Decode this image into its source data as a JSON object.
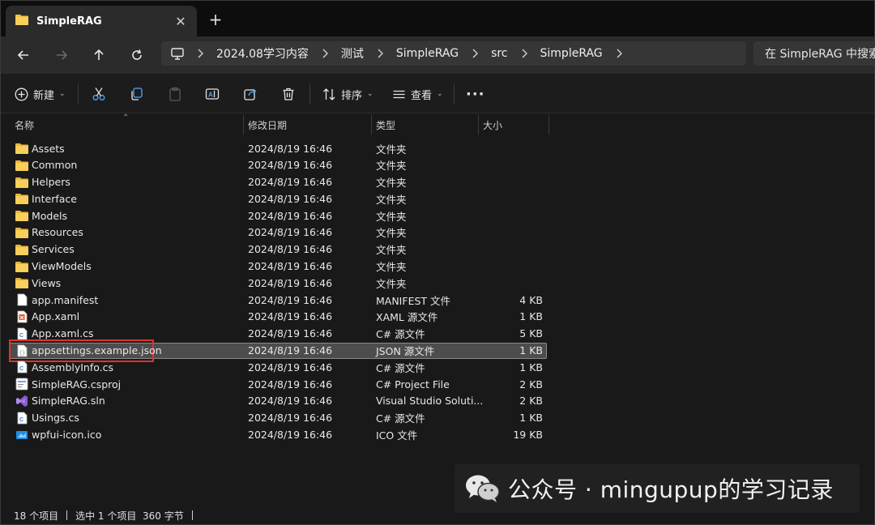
{
  "tab": {
    "title": "SimpleRAG",
    "close_glyph": "✕",
    "new_tab_glyph": "+"
  },
  "address": {
    "crumbs": [
      "2024.08学习内容",
      "测试",
      "SimpleRAG",
      "src",
      "SimpleRAG"
    ],
    "search_placeholder": "在 SimpleRAG 中搜索"
  },
  "toolbar": {
    "new_label": "新建",
    "sort_label": "排序",
    "view_label": "查看",
    "more_glyph": "···"
  },
  "columns": {
    "name": "名称",
    "date": "修改日期",
    "type": "类型",
    "size": "大小"
  },
  "files": [
    {
      "name": "Assets",
      "date": "2024/8/19 16:46",
      "type": "文件夹",
      "size": "",
      "icon": "folder-icon"
    },
    {
      "name": "Common",
      "date": "2024/8/19 16:46",
      "type": "文件夹",
      "size": "",
      "icon": "folder-icon"
    },
    {
      "name": "Helpers",
      "date": "2024/8/19 16:46",
      "type": "文件夹",
      "size": "",
      "icon": "folder-icon"
    },
    {
      "name": "Interface",
      "date": "2024/8/19 16:46",
      "type": "文件夹",
      "size": "",
      "icon": "folder-icon"
    },
    {
      "name": "Models",
      "date": "2024/8/19 16:46",
      "type": "文件夹",
      "size": "",
      "icon": "folder-icon"
    },
    {
      "name": "Resources",
      "date": "2024/8/19 16:46",
      "type": "文件夹",
      "size": "",
      "icon": "folder-icon"
    },
    {
      "name": "Services",
      "date": "2024/8/19 16:46",
      "type": "文件夹",
      "size": "",
      "icon": "folder-icon"
    },
    {
      "name": "ViewModels",
      "date": "2024/8/19 16:46",
      "type": "文件夹",
      "size": "",
      "icon": "folder-icon"
    },
    {
      "name": "Views",
      "date": "2024/8/19 16:46",
      "type": "文件夹",
      "size": "",
      "icon": "folder-icon"
    },
    {
      "name": "app.manifest",
      "date": "2024/8/19 16:46",
      "type": "MANIFEST 文件",
      "size": "4 KB",
      "icon": "file-icon"
    },
    {
      "name": "App.xaml",
      "date": "2024/8/19 16:46",
      "type": "XAML 源文件",
      "size": "1 KB",
      "icon": "xaml-file-icon"
    },
    {
      "name": "App.xaml.cs",
      "date": "2024/8/19 16:46",
      "type": "C# 源文件",
      "size": "5 KB",
      "icon": "csharp-file-icon"
    },
    {
      "name": "appsettings.example.json",
      "date": "2024/8/19 16:46",
      "type": "JSON 源文件",
      "size": "1 KB",
      "icon": "json-file-icon",
      "selected": true
    },
    {
      "name": "AssemblyInfo.cs",
      "date": "2024/8/19 16:46",
      "type": "C# 源文件",
      "size": "1 KB",
      "icon": "csharp-file-icon"
    },
    {
      "name": "SimpleRAG.csproj",
      "date": "2024/8/19 16:46",
      "type": "C# Project File",
      "size": "2 KB",
      "icon": "csproj-file-icon"
    },
    {
      "name": "SimpleRAG.sln",
      "date": "2024/8/19 16:46",
      "type": "Visual Studio Soluti...",
      "size": "2 KB",
      "icon": "sln-file-icon"
    },
    {
      "name": "Usings.cs",
      "date": "2024/8/19 16:46",
      "type": "C# 源文件",
      "size": "1 KB",
      "icon": "csharp-file-icon"
    },
    {
      "name": "wpfui-icon.ico",
      "date": "2024/8/19 16:46",
      "type": "ICO 文件",
      "size": "19 KB",
      "icon": "ico-file-icon"
    }
  ],
  "status": {
    "count": "18 个项目",
    "selection": "选中 1 个项目  360 字节"
  },
  "watermark": {
    "text": "公众号 · mingupup的学习记录"
  },
  "colors": {
    "folder": "#f3c246",
    "selection_outline": "#e0322f",
    "accent_blue": "#4aa8ff"
  }
}
